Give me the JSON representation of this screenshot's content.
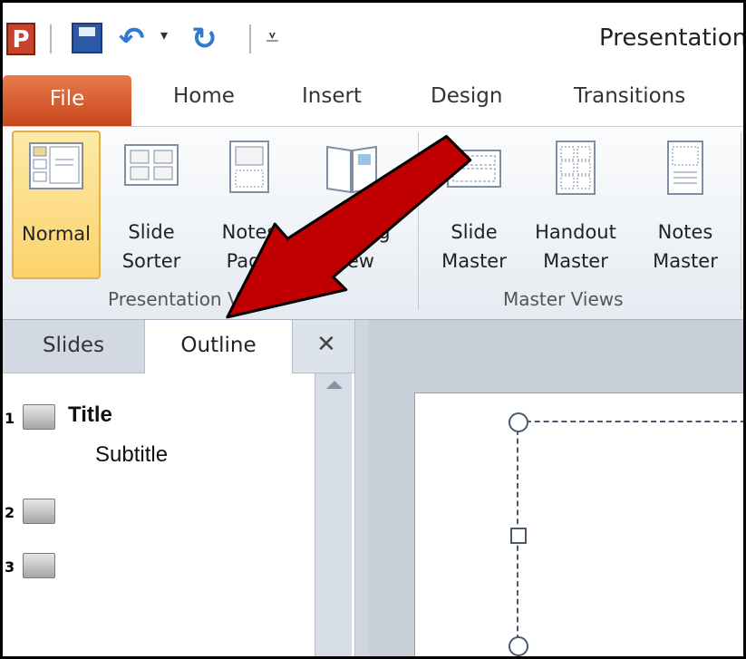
{
  "app": {
    "app_icon_letter": "P",
    "window_title": "Presentation"
  },
  "ribbon_tabs": {
    "file": "File",
    "home": "Home",
    "insert": "Insert",
    "design": "Design",
    "transitions": "Transitions"
  },
  "ribbon": {
    "normal": "Normal",
    "slide_sorter": "Slide\nSorter",
    "notes_page": "Notes\nPage",
    "reading_view": "Reading\nView",
    "slide_master": "Slide\nMaster",
    "handout_master": "Handout\nMaster",
    "notes_master": "Notes\nMaster",
    "group_presentation": "Presentation Views",
    "group_master": "Master Views"
  },
  "panel": {
    "tab_slides": "Slides",
    "tab_outline": "Outline",
    "close_label": "✕",
    "rows": [
      {
        "num": "1",
        "title": "Title"
      },
      {
        "num": "2",
        "title": ""
      },
      {
        "num": "3",
        "title": ""
      }
    ],
    "subtitle": "Subtitle"
  },
  "colors": {
    "annotation_arrow": "#c00000",
    "file_tab": "#d45a2a",
    "selected_button": "#fbd36a"
  }
}
